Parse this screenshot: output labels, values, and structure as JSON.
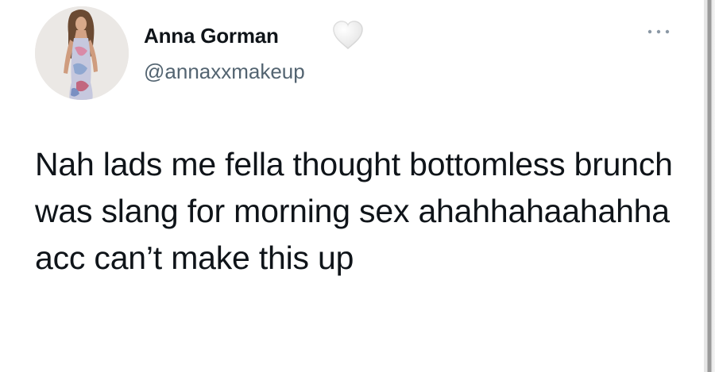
{
  "tweet": {
    "author": {
      "display_name": "Anna Gorman",
      "handle": "@annaxxmakeup",
      "avatar_icon": "profile-photo",
      "badge_icon": "white-heart-icon"
    },
    "menu_icon": "more-options-icon",
    "text": "Nah lads me fella thought bottomless brunch was slang for morning sex ahahhahaahahha acc can’t make this up"
  },
  "colors": {
    "text_primary": "#0f1419",
    "text_secondary": "#536471",
    "background": "#ffffff"
  }
}
